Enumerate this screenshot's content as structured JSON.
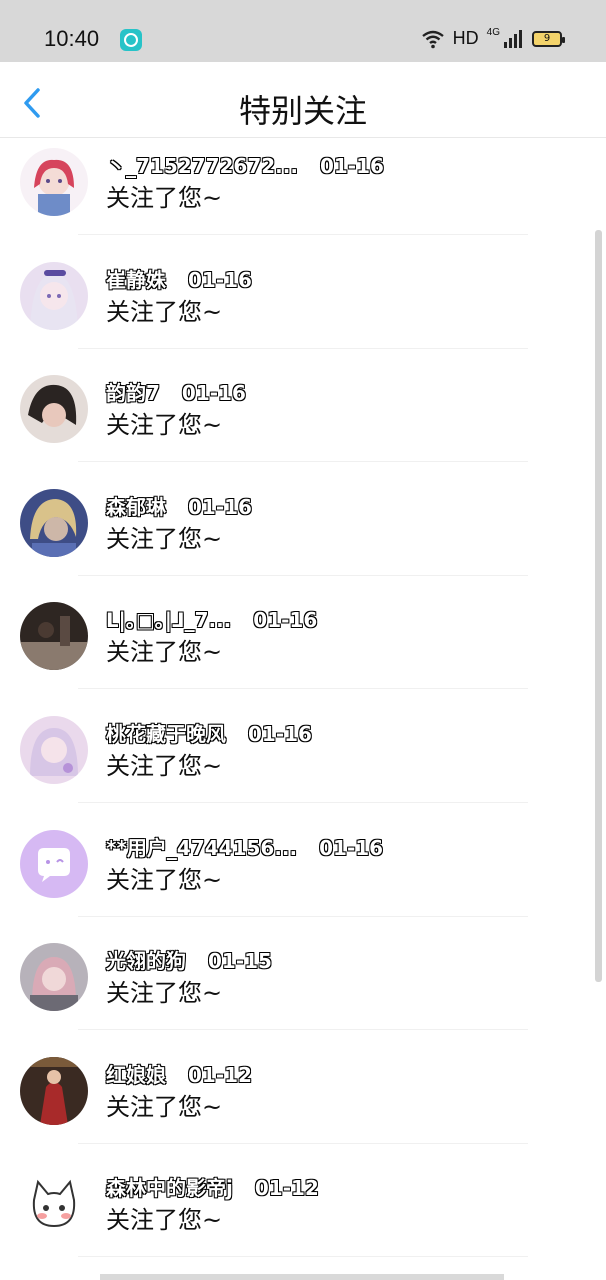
{
  "status_bar": {
    "time": "10:40",
    "network": "HD",
    "network_gen": "4G",
    "battery": "9"
  },
  "header": {
    "title": "特别关注",
    "back_icon": "chevron-left-icon",
    "accent_color": "#2f9bf0"
  },
  "items": [
    {
      "name": "丶_7152772672...",
      "date": "01-16",
      "message": "关注了您~",
      "avatar": "anime-girl-red-hair"
    },
    {
      "name": "崔静姝",
      "date": "01-16",
      "message": "关注了您~",
      "avatar": "anime-girl-purple"
    },
    {
      "name": "韵韵7",
      "date": "01-16",
      "message": "关注了您~",
      "avatar": "photo-person"
    },
    {
      "name": "森郁琳",
      "date": "01-16",
      "message": "关注了您~",
      "avatar": "game-character-blonde"
    },
    {
      "name": "ᒪ|｡□｡|ᒧ_7...",
      "date": "01-16",
      "message": "关注了您~",
      "avatar": "dark-photo"
    },
    {
      "name": "桃花藏于晚风",
      "date": "01-16",
      "message": "关注了您~",
      "avatar": "anime-girl-pink"
    },
    {
      "name": "**用户_4744156...",
      "date": "01-16",
      "message": "关注了您~",
      "avatar": "default-chat-avatar"
    },
    {
      "name": "光翎的狗",
      "date": "01-15",
      "message": "关注了您~",
      "avatar": "anime-girl-grey"
    },
    {
      "name": "红娘娘",
      "date": "01-12",
      "message": "关注了您~",
      "avatar": "red-dress-photo"
    },
    {
      "name": "森林中的影帝j",
      "date": "01-12",
      "message": "关注了您~",
      "avatar": "cartoon-cat"
    }
  ]
}
